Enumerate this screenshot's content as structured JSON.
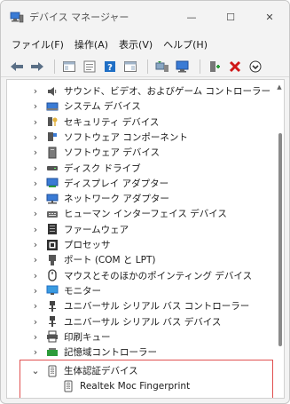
{
  "window": {
    "title": "デバイス マネージャー",
    "controls": {
      "minimize": "—",
      "maximize": "☐",
      "close": "✕"
    }
  },
  "menu": [
    {
      "label": "ファイル(F)"
    },
    {
      "label": "操作(A)"
    },
    {
      "label": "表示(V)"
    },
    {
      "label": "ヘルプ(H)"
    }
  ],
  "toolbar": {
    "icons": [
      "back-arrow-icon",
      "forward-arrow-icon",
      "show-hide-console-tree-icon",
      "properties-icon",
      "help-icon",
      "action-pane-icon",
      "update-driver-icon",
      "scan-hardware-icon",
      "add-legacy-hardware-icon",
      "uninstall-icon",
      "download-driver-icon"
    ]
  },
  "tree": {
    "items": [
      {
        "label": "サウンド、ビデオ、およびゲーム コントローラー",
        "icon": "speaker-icon",
        "expanded": false
      },
      {
        "label": "システム デバイス",
        "icon": "system-device-icon",
        "expanded": false
      },
      {
        "label": "セキュリティ デバイス",
        "icon": "security-key-icon",
        "expanded": false
      },
      {
        "label": "ソフトウェア コンポーネント",
        "icon": "software-component-icon",
        "expanded": false
      },
      {
        "label": "ソフトウェア デバイス",
        "icon": "software-device-icon",
        "expanded": false
      },
      {
        "label": "ディスク ドライブ",
        "icon": "disk-drive-icon",
        "expanded": false
      },
      {
        "label": "ディスプレイ アダプター",
        "icon": "display-adapter-icon",
        "expanded": false
      },
      {
        "label": "ネットワーク アダプター",
        "icon": "network-adapter-icon",
        "expanded": false
      },
      {
        "label": "ヒューマン インターフェイス デバイス",
        "icon": "hid-icon",
        "expanded": false
      },
      {
        "label": "ファームウェア",
        "icon": "firmware-icon",
        "expanded": false
      },
      {
        "label": "プロセッサ",
        "icon": "processor-icon",
        "expanded": false
      },
      {
        "label": "ポート (COM と LPT)",
        "icon": "port-icon",
        "expanded": false
      },
      {
        "label": "マウスとそのほかのポインティング デバイス",
        "icon": "mouse-icon",
        "expanded": false
      },
      {
        "label": "モニター",
        "icon": "monitor-icon",
        "expanded": false
      },
      {
        "label": "ユニバーサル シリアル バス コントローラー",
        "icon": "usb-controller-icon",
        "expanded": false
      },
      {
        "label": "ユニバーサル シリアル バス デバイス",
        "icon": "usb-device-icon",
        "expanded": false
      },
      {
        "label": "印刷キュー",
        "icon": "printer-icon",
        "expanded": false
      },
      {
        "label": "記憶域コントローラー",
        "icon": "storage-controller-icon",
        "expanded": false
      },
      {
        "label": "生体認証デバイス",
        "icon": "biometric-icon",
        "expanded": true
      }
    ],
    "child": {
      "label": "Realtek Moc Fingerprint",
      "icon": "fingerprint-icon"
    }
  },
  "colors": {
    "highlight": "#e05050",
    "accent_blue": "#1f6fc5",
    "uninstall_red": "#d01818",
    "update_green": "#2d9b3a"
  }
}
